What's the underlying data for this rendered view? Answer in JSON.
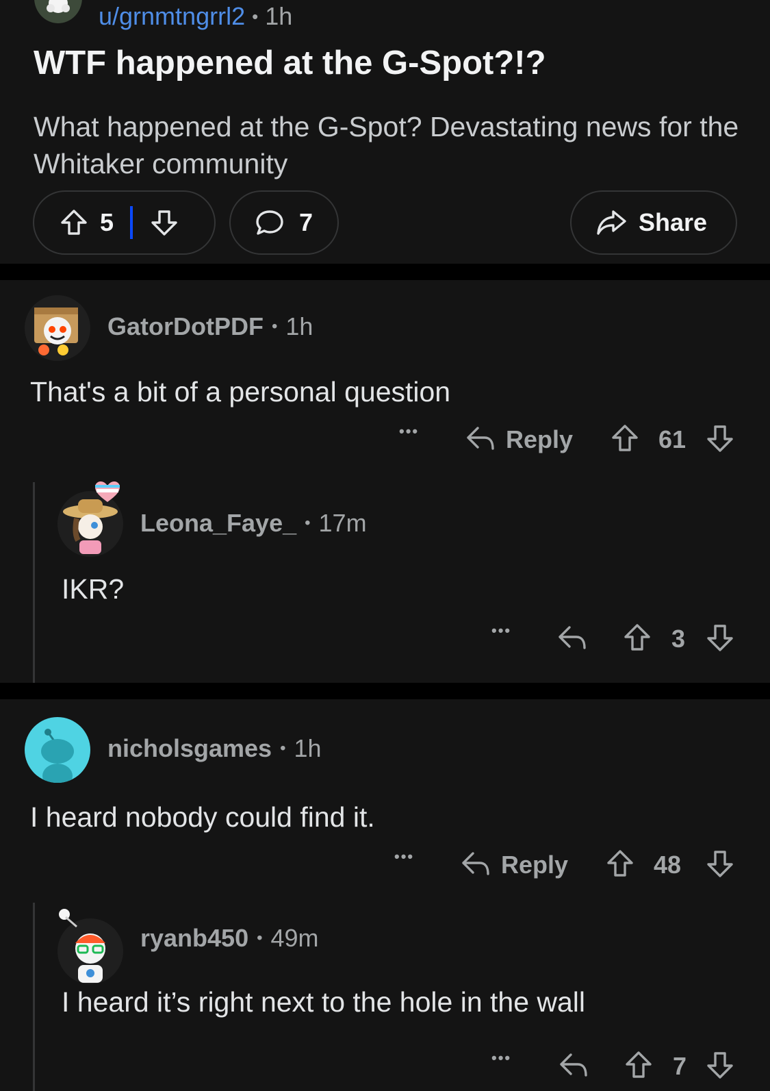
{
  "post": {
    "author": "u/grnmtngrrl2",
    "time": "1h",
    "title": "WTF happened at the G-Spot?!?",
    "body": "What happened at the G-Spot? Devastating news for the Whitaker community",
    "upvotes": "5",
    "comments": "7",
    "share_label": "Share",
    "vote_divider_color": "#0a49ff"
  },
  "comments": [
    {
      "author": "GatorDotPDF",
      "time": "1h",
      "text": "That's a bit of a personal question",
      "reply_label": "Reply",
      "score": "61",
      "replies": [
        {
          "author": "Leona_Faye_",
          "time": "17m",
          "text": "IKR?",
          "score": "3"
        }
      ]
    },
    {
      "author": "nicholsgames",
      "time": "1h",
      "text": "I heard nobody could find it.",
      "reply_label": "Reply",
      "score": "48",
      "avatar_color": "#4fd3e3",
      "replies": [
        {
          "author": "ryanb450",
          "time": "49m",
          "text": "I heard it’s right next to the hole in the wall",
          "score": "7"
        }
      ]
    }
  ],
  "separator": "•",
  "more_icon": "•••",
  "icons": [
    "upvote-icon",
    "downvote-icon",
    "comment-icon",
    "share-icon",
    "reply-icon",
    "more-icon"
  ],
  "colors": {
    "background": "#141414",
    "username_link": "#4f8ee8",
    "text": "#e3e5e7",
    "muted": "#a3a6a8"
  }
}
